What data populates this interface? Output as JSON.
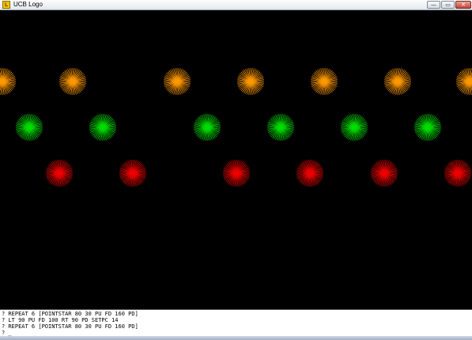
{
  "window": {
    "title": "UCB Logo",
    "icon": "logo-app-icon",
    "controls": {
      "minimize": "—",
      "maximize": "▭",
      "close": "✕"
    }
  },
  "canvas": {
    "background": "#000000",
    "rows": [
      {
        "color": "#ff9900",
        "stars": 7
      },
      {
        "color": "#00dd00",
        "stars": 6
      },
      {
        "color": "#ee0000",
        "stars": 6
      }
    ]
  },
  "console": {
    "lines": [
      "? REPEAT 6 [POINTSTAR 80 30 PU FD 160 PD]",
      "? LT 90 PU FD 100 RT 90 PD SETPC 14",
      "? REPEAT 6 [POINTSTAR 80 30 PU FD 160 PD]",
      "? _"
    ]
  }
}
